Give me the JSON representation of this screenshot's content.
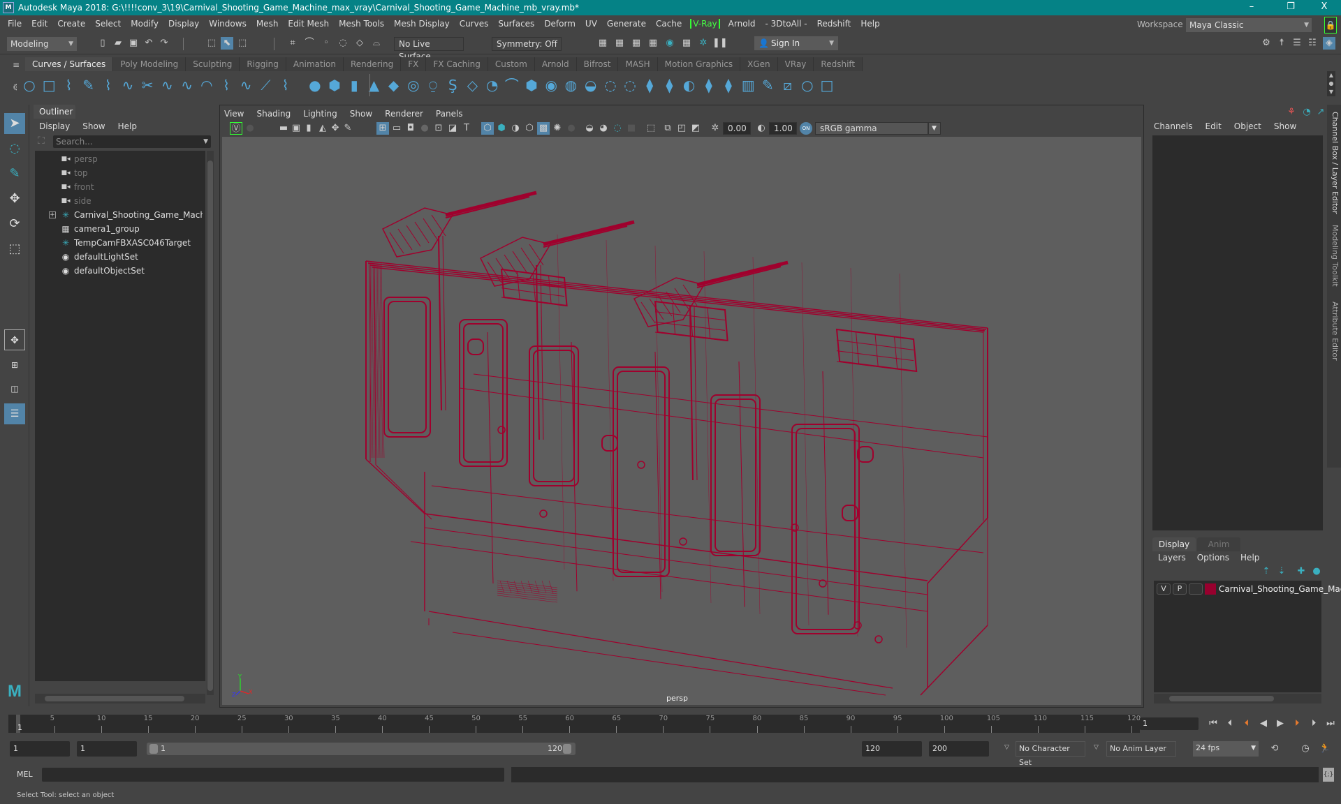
{
  "window": {
    "title": "Autodesk Maya 2018: G:\\!!!!conv_3\\19\\Carnival_Shooting_Game_Machine_max_vray\\Carnival_Shooting_Game_Machine_mb_vray.mb*",
    "logo": "M",
    "controls": {
      "minimize": "–",
      "restore": "❐",
      "close": "X"
    }
  },
  "menubar": {
    "items": [
      "File",
      "Edit",
      "Create",
      "Select",
      "Modify",
      "Display",
      "Windows",
      "Mesh",
      "Edit Mesh",
      "Mesh Tools",
      "Mesh Display",
      "Curves",
      "Surfaces",
      "Deform",
      "UV",
      "Generate",
      "Cache",
      "V-Ray",
      "Arnold",
      "- 3DtoAll -",
      "Redshift",
      "Help"
    ],
    "workspace_label": "Workspace :",
    "workspace_value": "Maya Classic"
  },
  "statusline": {
    "mode": "Modeling",
    "live_surface": "No Live Surface",
    "symmetry": "Symmetry: Off",
    "sign_in": "Sign In"
  },
  "shelf": {
    "tabs": [
      "Curves / Surfaces",
      "Poly Modeling",
      "Sculpting",
      "Rigging",
      "Animation",
      "Rendering",
      "FX",
      "FX Caching",
      "Custom",
      "Arnold",
      "Bifrost",
      "MASH",
      "Motion Graphics",
      "XGen",
      "VRay",
      "Redshift"
    ],
    "active_tab": "Curves / Surfaces",
    "icons": [
      "nurbs-circle",
      "nurbs-square",
      "ep-curve",
      "pencil-curve",
      "cv-curve",
      "bezier-curve",
      "curve-cut",
      "curve-attach",
      "curve-detach",
      "arc-tool",
      "offset-curve",
      "rebuild-curve",
      "curve-fillet",
      "insert-knot",
      "nurbs-sphere",
      "nurbs-cube",
      "nurbs-cylinder",
      "nurbs-cone",
      "nurbs-plane",
      "nurbs-torus",
      "revolve",
      "loft",
      "planar",
      "extrude",
      "birail",
      "boundary",
      "square-surface",
      "bevel",
      "bevel-plus",
      "surface-fillet",
      "trim-tool",
      "untrim",
      "stitch",
      "project-curve",
      "intersect",
      "align",
      "attach-surface",
      "detach-surface",
      "rebuild-surface",
      "sculpt-surface",
      "insert-isoparm"
    ]
  },
  "outliner": {
    "title": "Outliner",
    "menu": [
      "Display",
      "Show",
      "Help"
    ],
    "search_placeholder": "Search...",
    "items": [
      {
        "label": "persp",
        "icon": "camera-icon",
        "dim": true
      },
      {
        "label": "top",
        "icon": "camera-icon",
        "dim": true
      },
      {
        "label": "front",
        "icon": "camera-icon",
        "dim": true
      },
      {
        "label": "side",
        "icon": "camera-icon",
        "dim": true
      },
      {
        "label": "Carnival_Shooting_Game_Machine_n",
        "icon": "transform-icon",
        "expandable": true
      },
      {
        "label": "camera1_group",
        "icon": "group-icon"
      },
      {
        "label": "TempCamFBXASC046Target",
        "icon": "transform-icon"
      },
      {
        "label": "defaultLightSet",
        "icon": "set-icon"
      },
      {
        "label": "defaultObjectSet",
        "icon": "set-icon"
      }
    ]
  },
  "viewport": {
    "menu": [
      "View",
      "Shading",
      "Lighting",
      "Show",
      "Renderer",
      "Panels"
    ],
    "exposure": "0.00",
    "gamma": "1.00",
    "color_management": "ON",
    "color_space": "sRGB gamma",
    "camera_label": "persp",
    "axis": {
      "x": "X",
      "y": "Y",
      "z": "Z"
    },
    "wire_color": "#a0002d",
    "bg_color": "#5e5e5e"
  },
  "channel_box": {
    "menu": [
      "Channels",
      "Edit",
      "Object",
      "Show"
    ]
  },
  "layer_editor": {
    "tabs": [
      "Display",
      "Anim"
    ],
    "active_tab": "Display",
    "menu": [
      "Layers",
      "Options",
      "Help"
    ],
    "layers": [
      {
        "visible": "V",
        "playback": "P",
        "color": "#98002e",
        "name": "Carnival_Shooting_Game_Mac"
      }
    ]
  },
  "side_tabs": [
    "Channel Box / Layer Editor",
    "Modeling Toolkit",
    "Attribute Editor"
  ],
  "timeline": {
    "ticks": [
      5,
      10,
      15,
      20,
      25,
      30,
      35,
      40,
      45,
      50,
      55,
      60,
      65,
      70,
      75,
      80,
      85,
      90,
      95,
      100,
      105,
      110,
      115,
      120
    ],
    "start": 1,
    "end": 120,
    "current_frame": "1",
    "current_frame_field": "1"
  },
  "range": {
    "start_field": "1",
    "playback_start": "1",
    "slider_start": "1",
    "slider_end": "120",
    "playback_end": "120",
    "end_field": "200",
    "character_set": "No Character Set",
    "anim_layer": "No Anim Layer",
    "fps": "24 fps"
  },
  "command_line": {
    "lang": "MEL"
  },
  "help_line": {
    "text": "Select Tool: select an object"
  }
}
